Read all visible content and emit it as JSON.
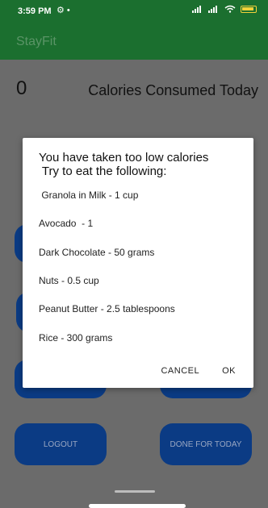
{
  "status_bar": {
    "time": "3:59 PM",
    "left_icons": "⚙ •",
    "icons": [
      "signal-icon",
      "signal-icon",
      "wifi-icon",
      "battery-icon"
    ]
  },
  "app_bar": {
    "title": "StayFit"
  },
  "main": {
    "calories_count": "0",
    "calories_label": "Calories Consumed Today",
    "logout_label": "LOGOUT",
    "done_label": "DONE FOR TODAY"
  },
  "dialog": {
    "title_line1": "You have taken too low calories",
    "title_line2": " Try to eat the following:",
    "items": [
      " Granola in Milk - 1 cup",
      "Avocado  - 1",
      "Dark Chocolate - 50 grams",
      "Nuts - 0.5 cup",
      "Peanut Butter - 2.5 tablespoons",
      "Rice - 300 grams"
    ],
    "cancel_label": "CANCEL",
    "ok_label": "OK"
  },
  "colors": {
    "app_bar": "#1b6f2f",
    "scrim": "#6b6b6b",
    "button": "#0b3b84"
  }
}
